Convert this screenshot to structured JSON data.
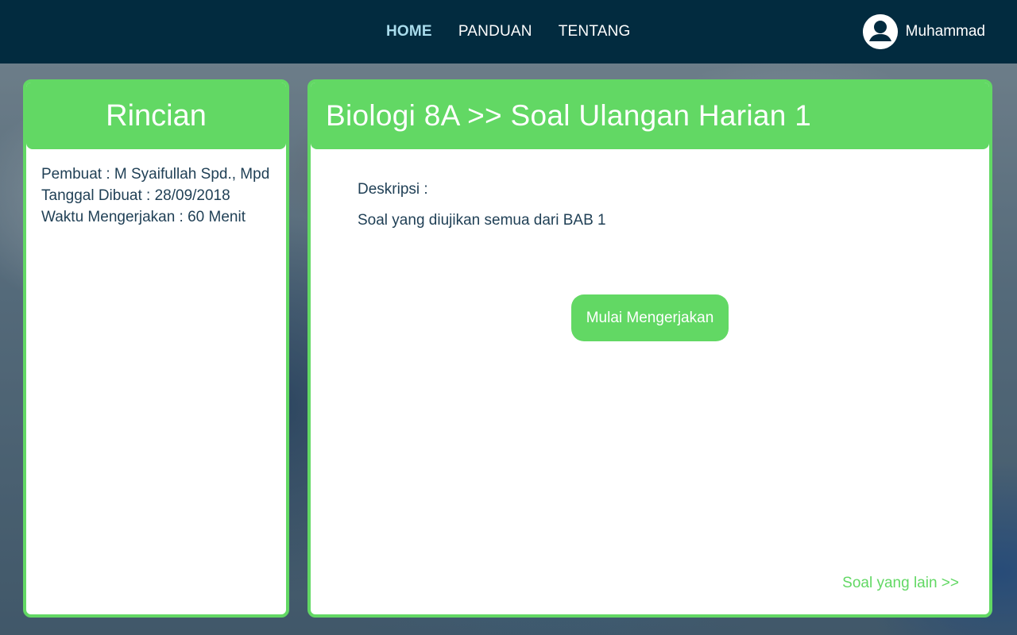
{
  "nav": {
    "links": [
      "HOME",
      "PANDUAN",
      "TENTANG"
    ],
    "active": "HOME",
    "user_name": "Muhammad",
    "user_icon": "user-circle-icon"
  },
  "details_card": {
    "title": "Rincian",
    "creator": "Pembuat : M Syaifullah Spd., Mpd",
    "date_created": "Tanggal Dibuat : 28/09/2018",
    "duration": "Waktu Mengerjakan : 60 Menit"
  },
  "quiz_card": {
    "title": "Biologi 8A >> Soal Ulangan Harian 1",
    "description_label": "Deskripsi :",
    "description": "Soal yang diujikan semua dari BAB 1",
    "start_button": "Mulai Mengerjakan",
    "more_link": "Soal yang lain >>"
  },
  "colors": {
    "navbar": "#022b3f",
    "accent_green": "#62d864",
    "active_nav": "#a9dcec",
    "text_dark": "#1f3f55"
  }
}
